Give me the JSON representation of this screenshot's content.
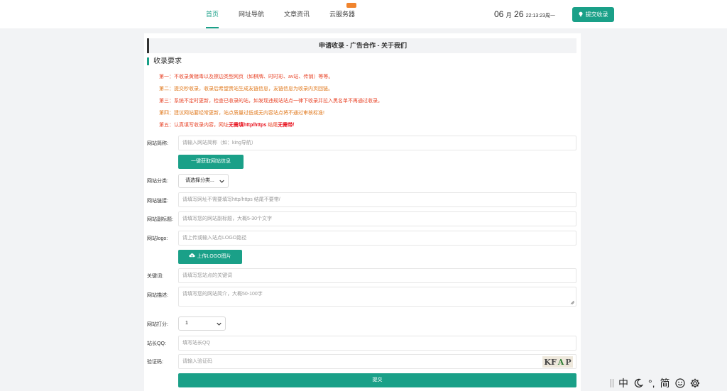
{
  "header": {
    "nav": [
      "首页",
      "网址导航",
      "文章资讯",
      "云服务器"
    ],
    "date": {
      "month": "06",
      "month_unit": "月",
      "day": "26",
      "time": "22:13:23",
      "weekday": "周一"
    },
    "submit_label": "提交收录"
  },
  "tabs_title": "申请收录 - 广告合作 - 关于我们",
  "requirements": {
    "title": "收录要求",
    "rules": [
      {
        "text": "第一：不收录黄赌毒以及擦边类型网页（如棋牌、时时彩、av站、传销）等等。"
      },
      {
        "text": "第二：提交秒收录，收录后希望贵站生成友链信息，友链信息为收录内页回链。"
      },
      {
        "text": "第三：系统不定时更新，检查已收录的站，如发现违规站站点一律下收录并拉入黑名单不再通过收录。"
      },
      {
        "text": "第四：建议网站要经常更新，站点质量过低或无内容站点将不通过审核标准!"
      },
      {
        "text_before": "第五：认真填写收录内容，网址",
        "text_bold1": "无需填http/https",
        "text_middle": " 结尾",
        "text_bold2": "无需带/"
      }
    ]
  },
  "form": {
    "name": {
      "label": "网站简称:",
      "placeholder": "请输入网站简称（如：king导航）"
    },
    "fetch_button": "一键获取网站信息",
    "category": {
      "label": "网站分类:",
      "selected": "请选择分类..."
    },
    "url": {
      "label": "网站链接:",
      "placeholder": "请填写网址不需要填写http/https 结尾不要带/"
    },
    "subtitle": {
      "label": "网站副标题:",
      "placeholder": "请填写您的网站副标题，大概5-30个文字"
    },
    "logo": {
      "label": "网站logo:",
      "placeholder": "请上传或输入站点LOGO路径"
    },
    "upload_button": "上传LOGO图片",
    "keywords": {
      "label": "关键词:",
      "placeholder": "请填写您站点的关键词"
    },
    "description": {
      "label": "网站描述:",
      "placeholder": "请填写您的网站简介，大概50-100字"
    },
    "rating": {
      "label": "网站打分:",
      "selected": "1"
    },
    "qq": {
      "label": "站长QQ:",
      "placeholder": "填写站长QQ"
    },
    "captcha": {
      "label": "验证码:",
      "placeholder": "请输入验证码",
      "code": [
        "KF",
        "A",
        "P"
      ]
    },
    "submit_button": "提交"
  },
  "ime": {
    "chinese": "中",
    "punct": "°,",
    "simplified": "简"
  },
  "colors": {
    "accent": "#1aa088",
    "warn_red": "#e8472b",
    "warn_orange": "#e07a1f",
    "hot": "#f0842e"
  }
}
